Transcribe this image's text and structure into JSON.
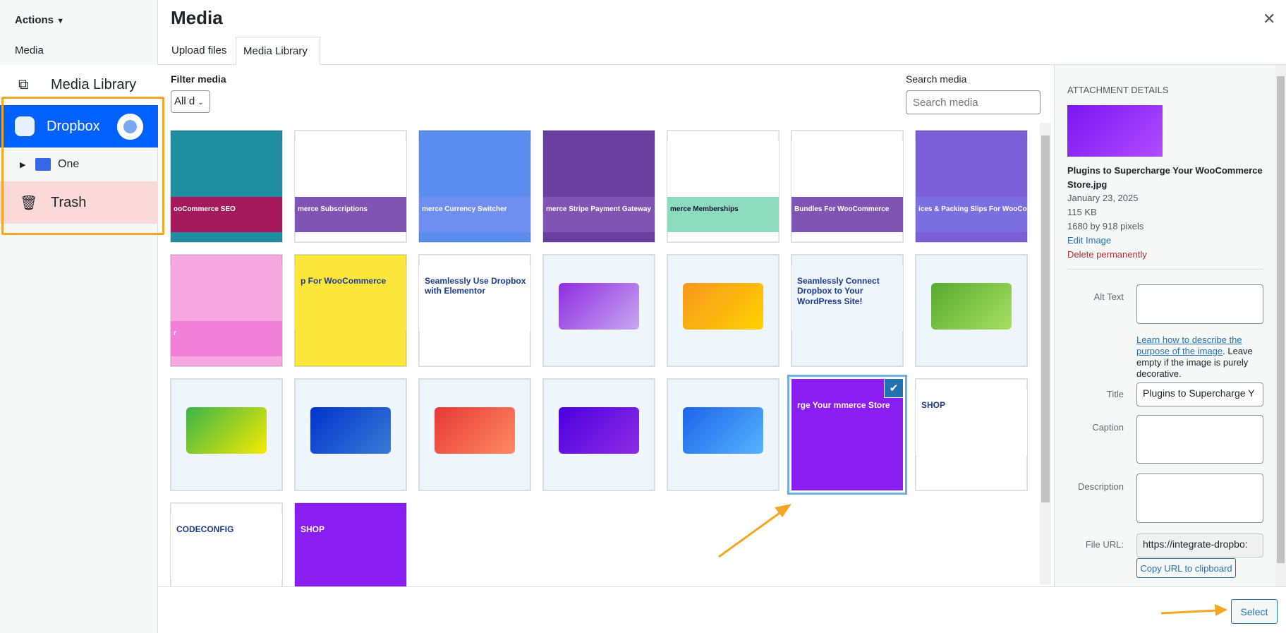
{
  "sidebar": {
    "actions_label": "Actions",
    "section_label": "Media",
    "items": [
      {
        "label": "Media Library",
        "icon": "media-library-icon"
      },
      {
        "label": "Dropbox",
        "icon": "dropbox-icon"
      },
      {
        "label": "One",
        "icon": "folder-icon"
      },
      {
        "label": "Trash",
        "icon": "trash-icon"
      }
    ]
  },
  "modal": {
    "title": "Media",
    "tabs": [
      {
        "label": "Upload files"
      },
      {
        "label": "Media Library",
        "active": true
      }
    ],
    "filter_label": "Filter media",
    "filter_value": "All d",
    "search_label": "Search media",
    "search_placeholder": "Search media"
  },
  "grid": {
    "items": [
      {
        "caption": "ooCommerce SEO",
        "bg": "#1f8ea0",
        "band": "#a3195b"
      },
      {
        "caption": "merce Subscriptions",
        "bg": "#ffffff",
        "band": "#7f54b3"
      },
      {
        "caption": "merce Currency Switcher",
        "bg": "#5b8def",
        "band": "#6f8ff0"
      },
      {
        "caption": "merce Stripe Payment Gateway",
        "bg": "#6b3fa0",
        "band": "#7f54b3"
      },
      {
        "caption": "merce Memberships",
        "bg": "#ffffff",
        "band": "#8edcc0"
      },
      {
        "caption": "Bundles For WooCommerce",
        "bg": "#ffffff",
        "band": "#7f54b3"
      },
      {
        "caption": "ices & Packing Slips For WooCommerce",
        "bg": "#7b5fd6",
        "band": "#7b6fe0"
      },
      {
        "caption": "r",
        "bg": "#f7a8e0",
        "band": "#f080d8"
      },
      {
        "caption": "p For WooCommerce",
        "bg": "#fde63b",
        "band": "#fde63b"
      },
      {
        "caption": "Seamlessly Use Dropbox with Elementor",
        "bg": "#ffffff",
        "band": "#ffffff"
      },
      {
        "caption": "",
        "card": "linear-gradient(135deg,#8e2de2,#c8a8f0)"
      },
      {
        "caption": "",
        "card": "linear-gradient(135deg,#f7971e,#ffd200)"
      },
      {
        "caption": "Seamlessly Connect Dropbox to Your WordPress Site!",
        "bg": "#eef6fb",
        "band": "#eef6fb"
      },
      {
        "caption": "",
        "card": "linear-gradient(135deg,#56ab2f,#a8e063)"
      },
      {
        "caption": "",
        "card": "linear-gradient(135deg,#39b54a,#f7ea00)"
      },
      {
        "caption": "",
        "card": "linear-gradient(135deg,#0033cc,#3a7bd5)"
      },
      {
        "caption": "",
        "card": "linear-gradient(135deg,#e53935,#ff8a65)"
      },
      {
        "caption": "",
        "card": "linear-gradient(135deg,#4a00e0,#8e2de2)"
      },
      {
        "caption": "",
        "card": "linear-gradient(135deg,#1e63e9,#56b4ff)"
      },
      {
        "caption": "rge Your mmerce Store",
        "bg": "#8a1df0",
        "band": "#8a1df0",
        "selected": true
      },
      {
        "caption": "SHOP",
        "bg": "#ffffff",
        "band": "#ffffff"
      },
      {
        "caption": "CODECONFIG",
        "bg": "#ffffff",
        "band": "#ffffff"
      },
      {
        "caption": "SHOP",
        "bg": "#8a1df0",
        "band": "#8a1df0"
      }
    ]
  },
  "attachment": {
    "heading": "ATTACHMENT DETAILS",
    "filename": "Plugins to Supercharge Your WooCommerce Store.jpg",
    "date": "January 23, 2025",
    "size": "115 KB",
    "dimensions": "1680 by 918 pixels",
    "edit_link": "Edit Image",
    "delete_link": "Delete permanently",
    "alt_label": "Alt Text",
    "alt_value": "",
    "alt_help_link": "Learn how to describe the purpose of the image",
    "alt_help_text": ". Leave empty if the image is purely decorative.",
    "title_label": "Title",
    "title_value": "Plugins to Supercharge Y",
    "caption_label": "Caption",
    "description_label": "Description",
    "url_label": "File URL:",
    "url_value": "https://integrate-dropbo:",
    "copy_button": "Copy URL to clipboard"
  },
  "footer": {
    "select_button": "Select"
  },
  "colors": {
    "accent": "#2271b1",
    "dropbox_active": "#0061fe",
    "trash_bg": "#fcd9d9",
    "annotation": "#f5a623",
    "danger": "#b32d2e"
  }
}
